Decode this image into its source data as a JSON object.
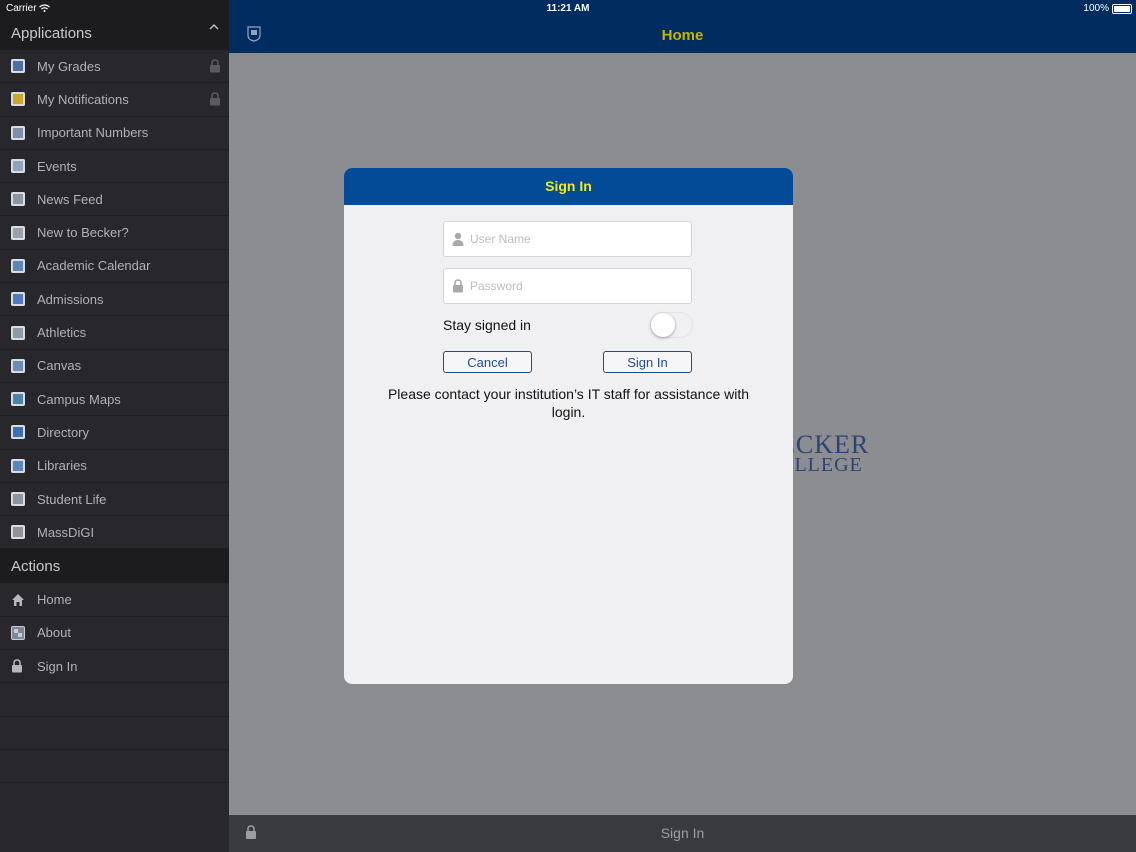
{
  "status_bar": {
    "carrier": "Carrier",
    "time": "11:21 AM",
    "battery": "100%"
  },
  "sidebar": {
    "applications_header": "Applications",
    "applications": [
      {
        "label": "My Grades",
        "icon": "grades-icon",
        "locked": true,
        "color": "#4a6fa5"
      },
      {
        "label": "My Notifications",
        "icon": "notifications-icon",
        "locked": true,
        "color": "#c8a82a"
      },
      {
        "label": "Important Numbers",
        "icon": "numbers-icon",
        "locked": false,
        "color": "#7b8fa8"
      },
      {
        "label": "Events",
        "icon": "events-icon",
        "locked": false,
        "color": "#8fa3bf"
      },
      {
        "label": "News Feed",
        "icon": "news-icon",
        "locked": false,
        "color": "#8d96a3"
      },
      {
        "label": "New to Becker?",
        "icon": "new-to-becker-icon",
        "locked": false,
        "color": "#9aa0a8"
      },
      {
        "label": "Academic Calendar",
        "icon": "calendar-icon",
        "locked": false,
        "color": "#5d85b5"
      },
      {
        "label": "Admissions",
        "icon": "admissions-icon",
        "locked": false,
        "color": "#4f7cc0"
      },
      {
        "label": "Athletics",
        "icon": "athletics-icon",
        "locked": false,
        "color": "#8d9aa8"
      },
      {
        "label": "Canvas",
        "icon": "canvas-icon",
        "locked": false,
        "color": "#6b8cb8"
      },
      {
        "label": "Campus Maps",
        "icon": "maps-icon",
        "locked": false,
        "color": "#4d84a8"
      },
      {
        "label": "Directory",
        "icon": "directory-icon",
        "locked": false,
        "color": "#3e6fb0"
      },
      {
        "label": "Libraries",
        "icon": "libraries-icon",
        "locked": false,
        "color": "#5a86bd"
      },
      {
        "label": "Student Life",
        "icon": "student-life-icon",
        "locked": false,
        "color": "#8c96a2"
      },
      {
        "label": "MassDiGI",
        "icon": "massdigi-icon",
        "locked": false,
        "color": "#8f9299"
      }
    ],
    "actions_header": "Actions",
    "actions": [
      {
        "label": "Home",
        "icon": "home-icon"
      },
      {
        "label": "About",
        "icon": "about-icon"
      },
      {
        "label": "Sign In",
        "icon": "lock-icon"
      }
    ]
  },
  "navbar": {
    "title": "Home"
  },
  "background_logo": {
    "line1": "ECKER",
    "line2": "OLLEGE"
  },
  "bottom_bar": {
    "label": "Sign In"
  },
  "signin_dialog": {
    "title": "Sign In",
    "username_placeholder": "User Name",
    "password_placeholder": "Password",
    "stay_signed_in_label": "Stay signed in",
    "stay_signed_in": false,
    "cancel_label": "Cancel",
    "signin_label": "Sign In",
    "help_text": "Please contact your institution’s IT staff for assistance with login."
  },
  "colors": {
    "navbar": "#012c5f",
    "dialog_header": "#034a97",
    "dialog_title": "#f4ec1a",
    "nav_title": "#c5b400",
    "button_border": "#1e4e8a"
  }
}
